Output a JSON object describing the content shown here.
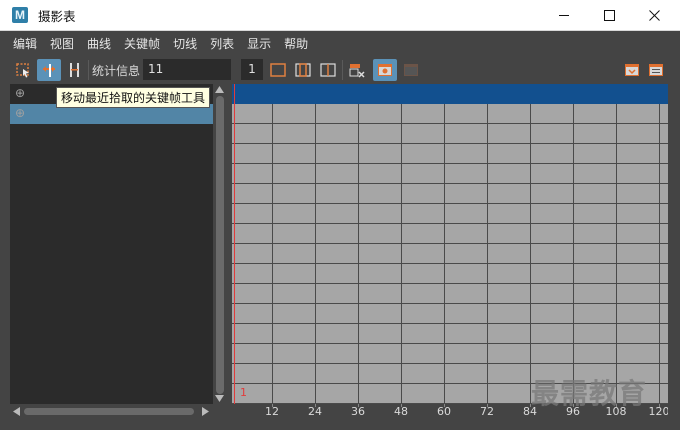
{
  "window": {
    "title": "摄影表",
    "app_icon": "M",
    "minimize_icon": "minimize-icon",
    "maximize_icon": "maximize-icon",
    "close_icon": "close-icon"
  },
  "menu": [
    "编辑",
    "视图",
    "曲线",
    "关键帧",
    "切线",
    "列表",
    "显示",
    "帮助"
  ],
  "toolbar": {
    "stats_label": "统计信息",
    "stats_value": "11",
    "frame_value": "1",
    "active_color": "#5b92b8",
    "icons": [
      "select-key-icon",
      "move-nearest-key-icon",
      "insert-keys-icon",
      "frame-all-icon",
      "frame-range-icon",
      "frame-selection-icon",
      "delete-key-icon",
      "view-camera-icon",
      "disabled-view-icon",
      "channel-box-icon",
      "outliner-icon"
    ]
  },
  "tooltip": "移动最近拾取的关键帧工具",
  "outliner": {
    "rows": [
      {
        "icon": "⊕",
        "selected": false
      },
      {
        "icon": "⊕",
        "selected": true
      }
    ],
    "selection_color": "#5285a6"
  },
  "timeline": {
    "current_frame": "1",
    "ticks": [
      "12",
      "24",
      "36",
      "48",
      "60",
      "72",
      "84",
      "96",
      "108",
      "120"
    ],
    "header_color": "#12508f",
    "grid_color": "#a6a6a6",
    "current_frame_color": "#e23b3b"
  },
  "watermark": "最需教育"
}
